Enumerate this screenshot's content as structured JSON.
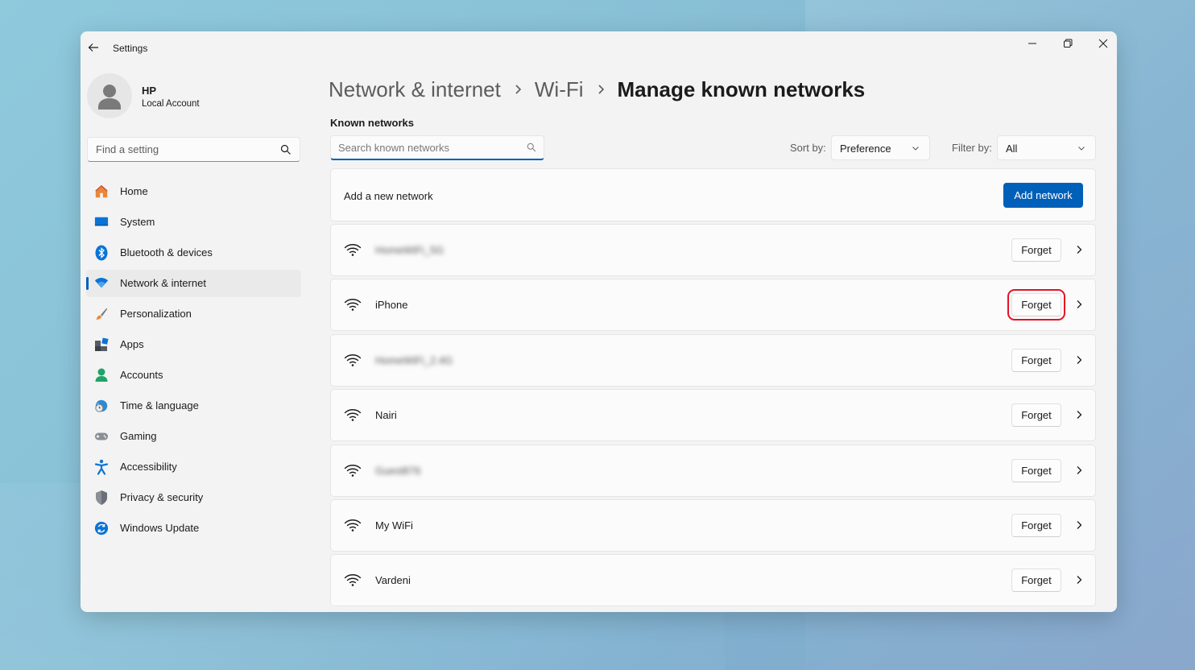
{
  "window": {
    "app_title": "Settings"
  },
  "profile": {
    "name": "HP",
    "account_type": "Local Account"
  },
  "sidebar": {
    "search_placeholder": "Find a setting",
    "items": [
      {
        "label": "Home",
        "icon": "home-icon",
        "active": false
      },
      {
        "label": "System",
        "icon": "system-icon",
        "active": false
      },
      {
        "label": "Bluetooth & devices",
        "icon": "bluetooth-icon",
        "active": false
      },
      {
        "label": "Network & internet",
        "icon": "network-icon",
        "active": true
      },
      {
        "label": "Personalization",
        "icon": "brush-icon",
        "active": false
      },
      {
        "label": "Apps",
        "icon": "apps-icon",
        "active": false
      },
      {
        "label": "Accounts",
        "icon": "accounts-icon",
        "active": false
      },
      {
        "label": "Time & language",
        "icon": "globe-clock-icon",
        "active": false
      },
      {
        "label": "Gaming",
        "icon": "gamepad-icon",
        "active": false
      },
      {
        "label": "Accessibility",
        "icon": "accessibility-icon",
        "active": false
      },
      {
        "label": "Privacy & security",
        "icon": "shield-icon",
        "active": false
      },
      {
        "label": "Windows Update",
        "icon": "update-icon",
        "active": false
      }
    ]
  },
  "breadcrumb": {
    "items": [
      "Network & internet",
      "Wi-Fi"
    ],
    "current": "Manage known networks"
  },
  "known_networks": {
    "section_title": "Known networks",
    "search_placeholder": "Search known networks",
    "sort_label": "Sort by:",
    "sort_value": "Preference",
    "filter_label": "Filter by:",
    "filter_value": "All",
    "add_text": "Add a new network",
    "add_button": "Add network",
    "forget_label": "Forget",
    "networks": [
      {
        "name": "HomeWiFi_5G",
        "blurred": true,
        "highlighted": false
      },
      {
        "name": "iPhone",
        "blurred": false,
        "highlighted": true
      },
      {
        "name": "HomeWiFi_2.4G",
        "blurred": true,
        "highlighted": false
      },
      {
        "name": "Nairi",
        "blurred": false,
        "highlighted": false
      },
      {
        "name": "Guest876",
        "blurred": true,
        "highlighted": false
      },
      {
        "name": "My WiFi",
        "blurred": false,
        "highlighted": false
      },
      {
        "name": "Vardeni",
        "blurred": false,
        "highlighted": false
      }
    ]
  },
  "colors": {
    "accent": "#005fb8",
    "highlight_box": "#e81123"
  }
}
